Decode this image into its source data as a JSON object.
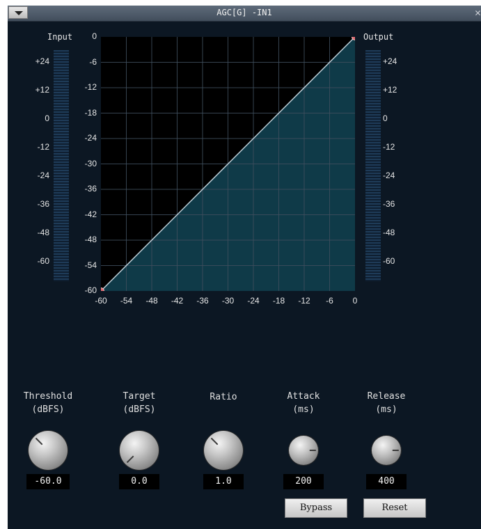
{
  "window": {
    "title": "AGC[G] -IN1"
  },
  "graph": {
    "input_label": "Input",
    "output_label": "Output",
    "meter_scale": [
      "+24",
      "+12",
      "0",
      "-12",
      "-24",
      "-36",
      "-48",
      "-60"
    ],
    "y_axis": [
      "0",
      "-6",
      "-12",
      "-18",
      "-24",
      "-30",
      "-36",
      "-42",
      "-48",
      "-54",
      "-60"
    ],
    "x_axis": [
      "-60",
      "-54",
      "-48",
      "-42",
      "-36",
      "-30",
      "-24",
      "-18",
      "-12",
      "-6",
      "0"
    ],
    "range_db": [
      -60,
      0
    ],
    "curve_points": [
      [
        -60,
        -60
      ],
      [
        0,
        0
      ]
    ],
    "colors": {
      "plot_bg": "#000000",
      "fill": "#0f3a48",
      "grid": "#3f4f5e",
      "line": "#bfcfd8",
      "handle": "#e06a70"
    }
  },
  "params": [
    {
      "label": "Threshold\n(dBFS)",
      "value": "-60.0",
      "level": 0.0
    },
    {
      "label": "Target\n(dBFS)",
      "value": "0.0",
      "level": 1.0
    },
    {
      "label": "Ratio",
      "value": "1.0",
      "level": 0.0
    },
    {
      "label": "Attack\n(ms)",
      "value": "200",
      "level": 0.5
    },
    {
      "label": "Release\n(ms)",
      "value": "400",
      "level": 0.5
    }
  ],
  "buttons": {
    "bypass": "Bypass",
    "reset": "Reset"
  }
}
